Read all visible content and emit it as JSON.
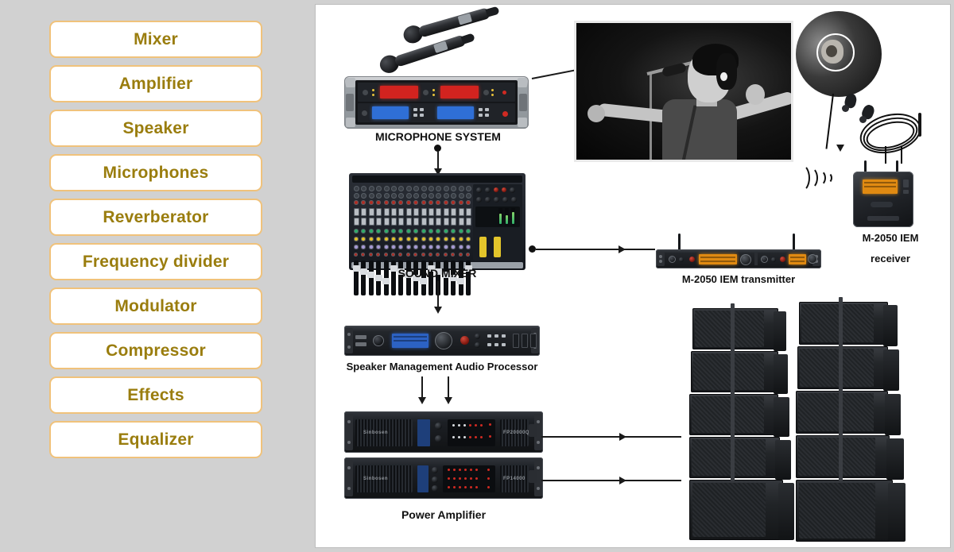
{
  "sidebar": {
    "items": [
      {
        "label": "Mixer"
      },
      {
        "label": "Amplifier"
      },
      {
        "label": "Speaker"
      },
      {
        "label": "Microphones"
      },
      {
        "label": "Reverberator"
      },
      {
        "label": "Frequency divider"
      },
      {
        "label": "Modulator"
      },
      {
        "label": "Compressor"
      },
      {
        "label": "Effects"
      },
      {
        "label": "Equalizer"
      }
    ],
    "accent_border": "#f0c27b",
    "text_color": "#9a7d0e",
    "background": "#d1d1d1"
  },
  "diagram": {
    "background": "#ffffff",
    "border_color": "#bdbdbd",
    "labels": {
      "microphone_system": "MICROPHONE SYSTEM",
      "sound_mixer": "SOUND MIXER",
      "iem_transmitter": "M-2050 IEM transmitter",
      "iem_receiver_line1": "M-2050 IEM",
      "iem_receiver_line2": "receiver",
      "audio_processor": "Speaker Management Audio Processor",
      "power_amplifier": "Power Amplifier"
    }
  }
}
